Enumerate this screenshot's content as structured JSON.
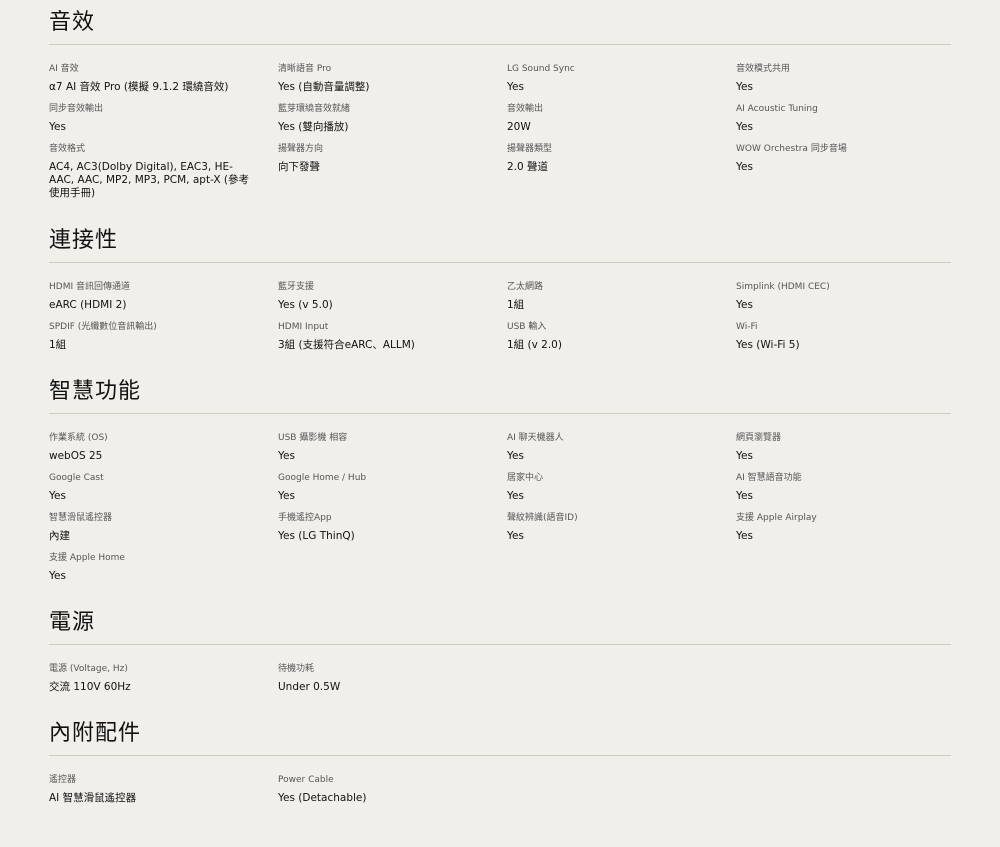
{
  "sections": {
    "audio": {
      "title": "音效",
      "rows": [
        [
          {
            "label": "AI 音效",
            "value": "α7 AI 音效 Pro (模擬 9.1.2 環繞音效)"
          },
          {
            "label": "清晰語音 Pro",
            "value": "Yes (自動音量調整)"
          },
          {
            "label": "LG Sound Sync",
            "value": "Yes"
          },
          {
            "label": "音效模式共用",
            "value": "Yes"
          }
        ],
        [
          {
            "label": "同步音效輸出",
            "value": "Yes"
          },
          {
            "label": "藍芽環繞音效就緒",
            "value": "Yes (雙向播放)"
          },
          {
            "label": "音效輸出",
            "value": "20W"
          },
          {
            "label": "AI Acoustic Tuning",
            "value": "Yes"
          }
        ],
        [
          {
            "label": "音效格式",
            "value": "AC4, AC3(Dolby Digital), EAC3, HE-AAC, AAC, MP2, MP3, PCM, apt-X (參考使用手冊)"
          },
          {
            "label": "揚聲器方向",
            "value": "向下發聲"
          },
          {
            "label": "揚聲器類型",
            "value": "2.0 聲道"
          },
          {
            "label": "WOW Orchestra 同步音場",
            "value": "Yes"
          }
        ]
      ]
    },
    "connectivity": {
      "title": "連接性",
      "rows": [
        [
          {
            "label": "HDMI 音訊回傳通道",
            "value": "eARC (HDMI 2)"
          },
          {
            "label": "藍牙支援",
            "value": "Yes (v 5.0)"
          },
          {
            "label": "乙太網路",
            "value": "1組"
          },
          {
            "label": "Simplink (HDMI CEC)",
            "value": "Yes"
          }
        ],
        [
          {
            "label": "SPDIF (光纖數位音訊輸出)",
            "value": "1組"
          },
          {
            "label": "HDMI Input",
            "value": "3組 (支援符合eARC、ALLM)"
          },
          {
            "label": "USB 輸入",
            "value": "1組 (v 2.0)"
          },
          {
            "label": "Wi-Fi",
            "value": "Yes (Wi-Fi 5)"
          }
        ]
      ]
    },
    "smart": {
      "title": "智慧功能",
      "rows": [
        [
          {
            "label": "作業系統 (OS)",
            "value": "webOS 25"
          },
          {
            "label": "USB 攝影機 相容",
            "value": "Yes"
          },
          {
            "label": "AI 聊天機器人",
            "value": "Yes"
          },
          {
            "label": "網頁瀏覽器",
            "value": "Yes"
          }
        ],
        [
          {
            "label": "Google Cast",
            "value": "Yes"
          },
          {
            "label": "Google Home / Hub",
            "value": "Yes"
          },
          {
            "label": "居家中心",
            "value": "Yes"
          },
          {
            "label": "AI 智慧語音功能",
            "value": "Yes"
          }
        ],
        [
          {
            "label": "智慧滑鼠遙控器",
            "value": "內建"
          },
          {
            "label": "手機遙控App",
            "value": "Yes (LG ThinQ)"
          },
          {
            "label": "聲紋辨識(語音ID)",
            "value": "Yes"
          },
          {
            "label": "支援 Apple Airplay",
            "value": "Yes"
          }
        ],
        [
          {
            "label": "支援 Apple Home",
            "value": "Yes"
          }
        ]
      ]
    },
    "power": {
      "title": "電源",
      "rows": [
        [
          {
            "label": "電源 (Voltage, Hz)",
            "value": "交流 110V 60Hz"
          },
          {
            "label": "待機功耗",
            "value": "Under 0.5W"
          }
        ]
      ]
    },
    "accessories": {
      "title": "內附配件",
      "rows": [
        [
          {
            "label": "遙控器",
            "value": "AI 智慧滑鼠遙控器"
          },
          {
            "label": "Power Cable",
            "value": "Yes (Detachable)"
          }
        ]
      ]
    }
  }
}
